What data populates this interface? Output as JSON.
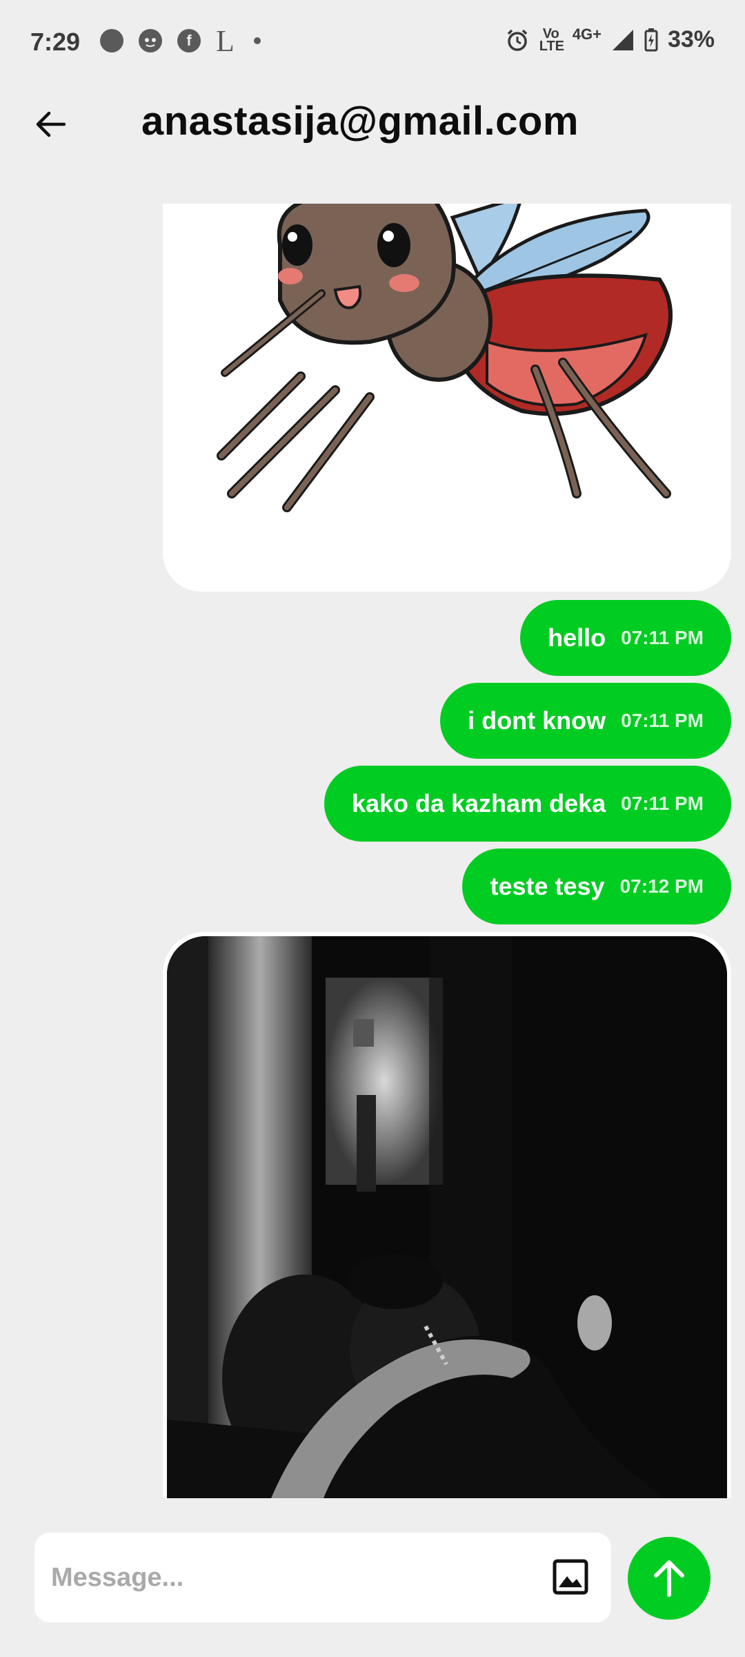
{
  "status_bar": {
    "time": "7:29",
    "notification_icons": [
      "signal-app-icon",
      "cat-app-icon",
      "facebook-icon",
      "l-app-icon",
      "dot-icon"
    ],
    "l_glyph": "L",
    "facebook_glyph": "f",
    "volte": "Vo LTE",
    "network": "4G+",
    "battery": "33%"
  },
  "header": {
    "title": "anastasija@gmail.com"
  },
  "messages": [
    {
      "text": "hello",
      "time": "07:11 PM"
    },
    {
      "text": "i dont know",
      "time": "07:11 PM"
    },
    {
      "text": "kako da kazham deka",
      "time": "07:11 PM"
    },
    {
      "text": "teste tesy",
      "time": "07:12 PM"
    }
  ],
  "composer": {
    "placeholder": "Message..."
  },
  "colors": {
    "accent": "#00cc22",
    "background": "#eeeeee",
    "bubble_text": "#ffffff"
  }
}
